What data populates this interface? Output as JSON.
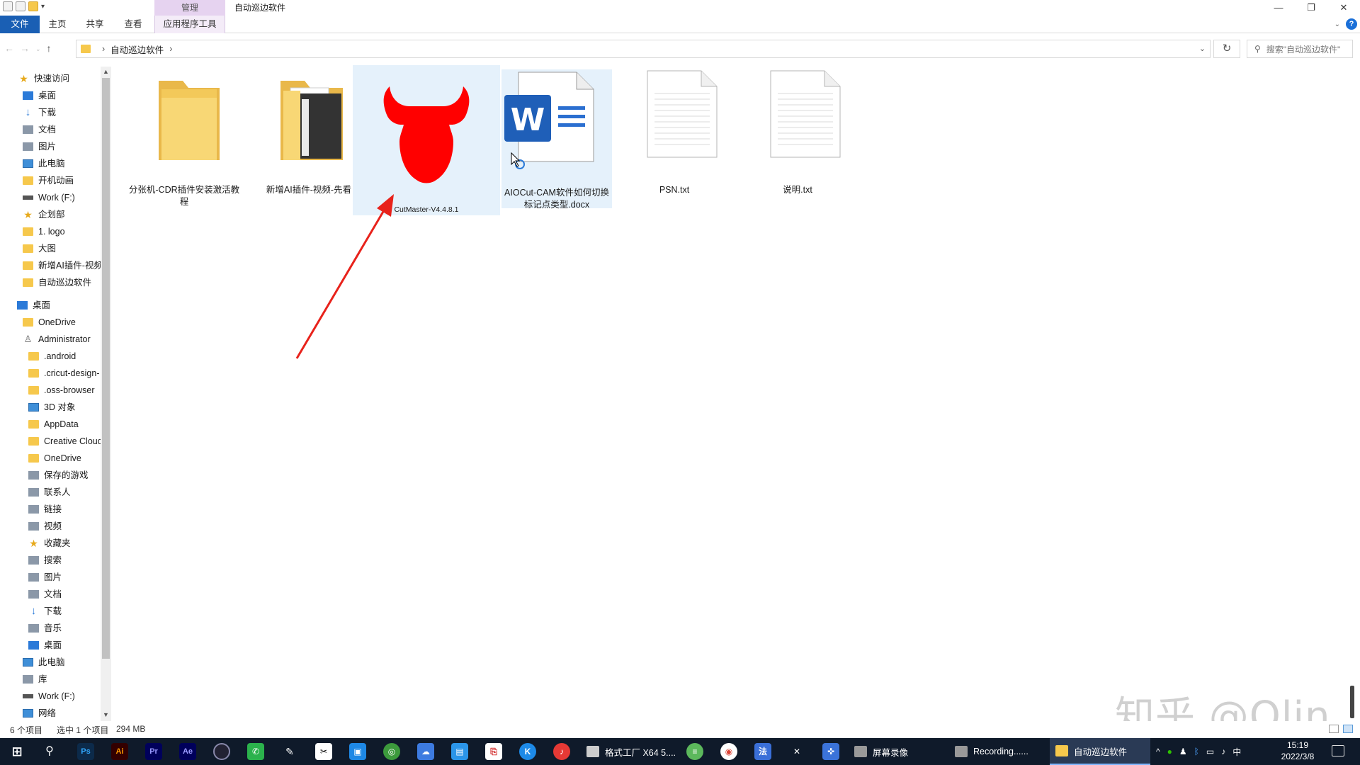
{
  "window": {
    "title": "自动巡边软件",
    "context_group": "管理",
    "ribbon_tabs": {
      "file": "文件",
      "home": "主页",
      "share": "共享",
      "view": "查看",
      "app_tools": "应用程序工具"
    },
    "controls": {
      "minimize": "—",
      "restore": "❐",
      "close": "✕"
    }
  },
  "address_bar": {
    "crumb": "自动巡边软件",
    "search_placeholder": "搜索\"自动巡边软件\""
  },
  "sidebar": {
    "quick_access": {
      "label": "快速访问",
      "items": [
        "桌面",
        "下载",
        "文档",
        "图片",
        "此电脑",
        "开机动画",
        "Work (F:)",
        "企划部",
        "1. logo",
        "大图",
        "新增AI插件-视频",
        "自动巡边软件"
      ]
    },
    "desktop": {
      "label": "桌面",
      "items": [
        "OneDrive",
        "Administrator",
        ".android",
        ".cricut-design-",
        ".oss-browser",
        "3D 对象",
        "AppData",
        "Creative Cloud",
        "OneDrive",
        "保存的游戏",
        "联系人",
        "链接",
        "视频",
        "收藏夹",
        "搜索",
        "图片",
        "文档",
        "下载",
        "音乐",
        "桌面",
        "此电脑",
        "库",
        "Work (F:)",
        "网络"
      ]
    }
  },
  "files": [
    {
      "name": "分张机-CDR插件安装激活教\n程",
      "type": "folder"
    },
    {
      "name": "新增AI插件-视频-先看",
      "type": "folder"
    },
    {
      "name": "CutMaster-V4.4.8.1",
      "type": "app"
    },
    {
      "name": "AIOCut-CAM软件如何切换\n标记点类型.docx",
      "type": "docx"
    },
    {
      "name": "PSN.txt",
      "type": "txt"
    },
    {
      "name": "说明.txt",
      "type": "txt"
    }
  ],
  "status": {
    "count": "6 个项目",
    "selected": "选中 1 个项目",
    "size": "294 MB"
  },
  "watermark": "知乎 @Qlin",
  "taskbar": {
    "apps": [
      {
        "label": "格式工厂 X64 5....",
        "icon": "format-factory-icon"
      },
      {
        "label": "屏幕录像",
        "icon": "screen-recorder-icon"
      },
      {
        "label": "Recording......",
        "icon": "recording-icon"
      },
      {
        "label": "自动巡边软件",
        "icon": "folder-icon"
      }
    ],
    "ime": "中",
    "time": "15:19",
    "date": "2022/3/8"
  },
  "colors": {
    "accent": "#1a5fb4",
    "selection": "#e5f1fb",
    "arrow": "#e8221b",
    "cutmaster_red": "#ff0000"
  }
}
